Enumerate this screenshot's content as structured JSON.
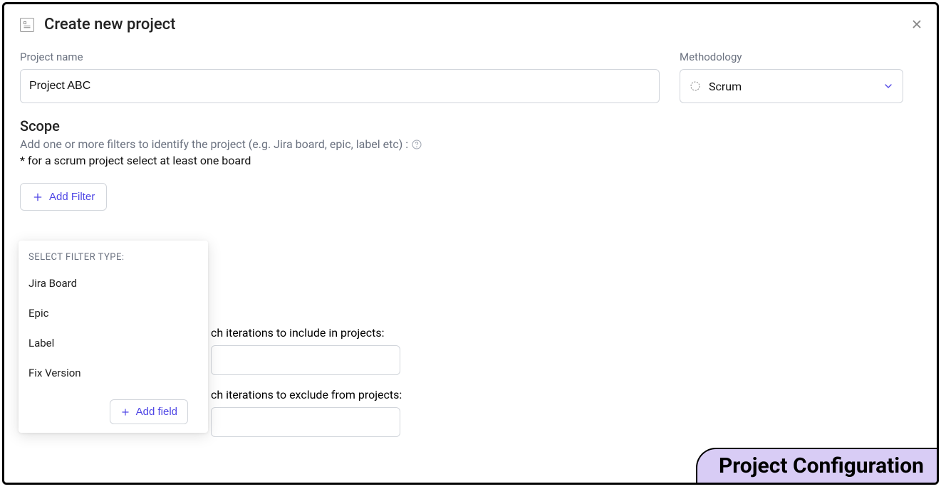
{
  "dialog": {
    "title": "Create new project"
  },
  "form": {
    "project_name_label": "Project name",
    "project_name_value": "Project ABC",
    "methodology_label": "Methodology",
    "methodology_value": "Scrum"
  },
  "scope": {
    "heading": "Scope",
    "hint": "Add one or more filters to identify the project (e.g. Jira board, epic, label etc) :",
    "note": "* for a scrum project select at least one board",
    "add_filter_label": "Add Filter"
  },
  "filter_dropdown": {
    "header": "SELECT FILTER TYPE:",
    "items": [
      "Jira Board",
      "Epic",
      "Label",
      "Fix Version"
    ],
    "add_field_label": "Add field"
  },
  "iterations": {
    "include_label": "ch iterations to include in projects:",
    "exclude_label": "ch iterations to exclude from projects:"
  },
  "footer_badge": "Project Configuration"
}
